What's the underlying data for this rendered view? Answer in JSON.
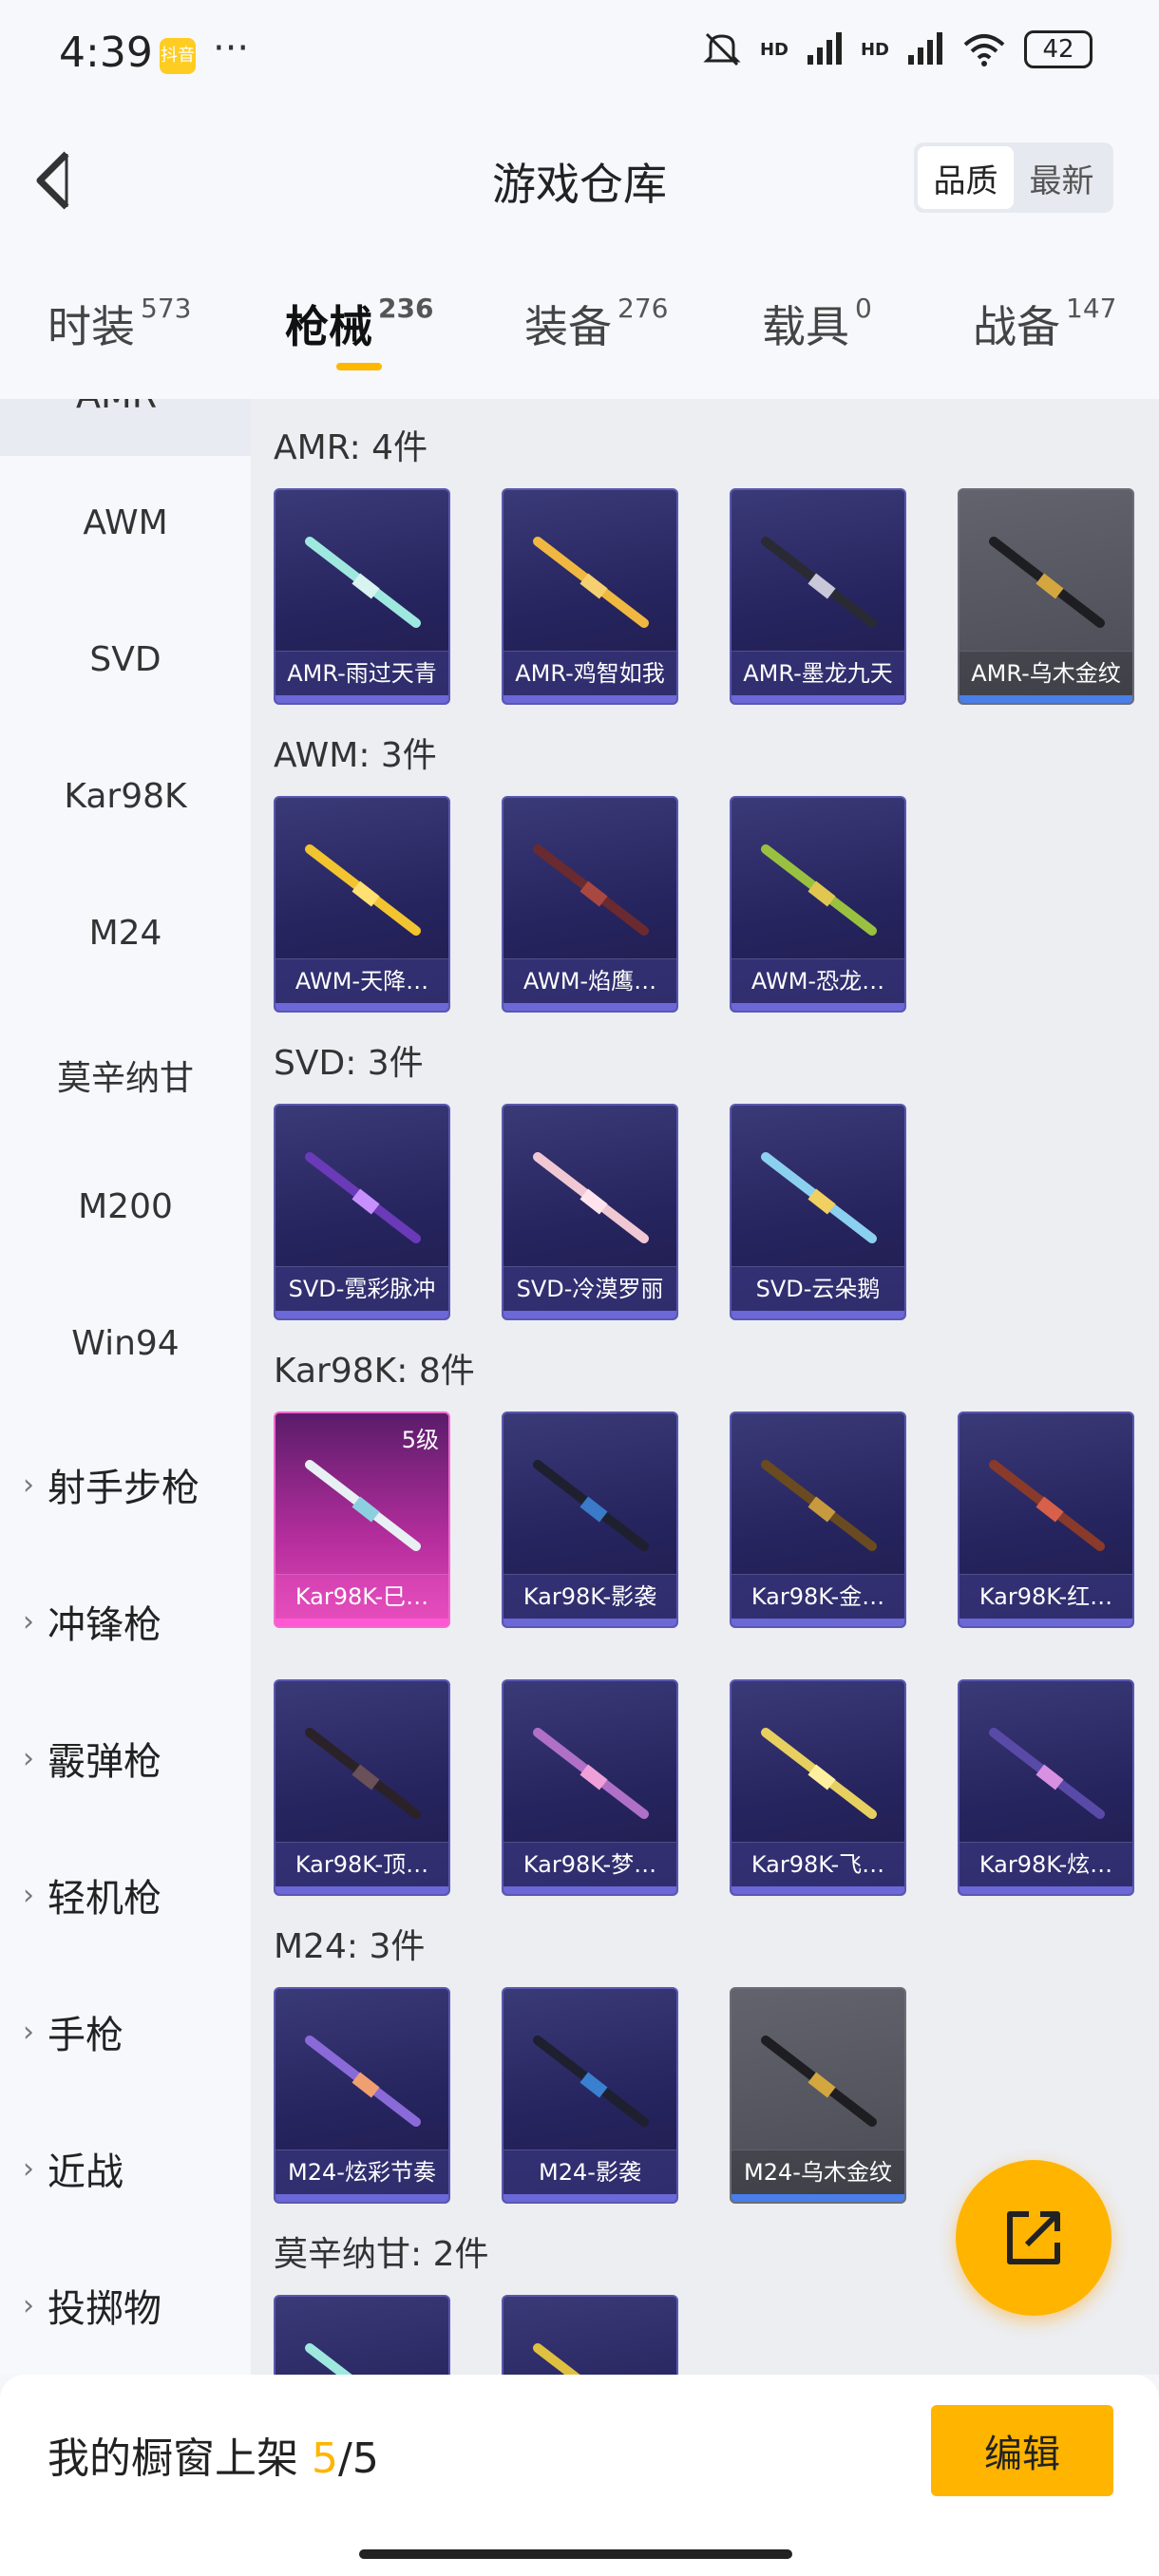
{
  "status": {
    "time": "4:39",
    "app_badge": "抖音",
    "dots": "···",
    "hd1": "HD",
    "hd2": "HD",
    "battery": "42"
  },
  "header": {
    "title": "游戏仓库",
    "sort_quality": "品质",
    "sort_latest": "最新"
  },
  "tabs": [
    {
      "label": "时装",
      "count": "573"
    },
    {
      "label": "枪械",
      "count": "236"
    },
    {
      "label": "装备",
      "count": "276"
    },
    {
      "label": "载具",
      "count": "0"
    },
    {
      "label": "战备",
      "count": "147"
    }
  ],
  "sidebar": {
    "cut_label": "AMR",
    "items": [
      "AWM",
      "SVD",
      "Kar98K",
      "M24",
      "莫辛纳甘",
      "M200",
      "Win94"
    ],
    "groups": [
      "射手步枪",
      "冲锋枪",
      "霰弹枪",
      "轻机枪",
      "手枪",
      "近战",
      "投掷物"
    ]
  },
  "sections": [
    {
      "title": "AMR: 4件",
      "cards": [
        "AMR-雨过天青",
        "AMR-鸡智如我",
        "AMR-墨龙九天",
        "AMR-乌木金纹"
      ]
    },
    {
      "title": "AWM: 3件",
      "cards": [
        "AWM-天降…",
        "AWM-焰鹰…",
        "AWM-恐龙…"
      ]
    },
    {
      "title": "SVD: 3件",
      "cards": [
        "SVD-霓彩脉冲",
        "SVD-冷漠罗丽",
        "SVD-云朵鹅"
      ]
    },
    {
      "title": "Kar98K: 8件",
      "level": "5级",
      "cards": [
        "Kar98K-巳…",
        "Kar98K-影袭",
        "Kar98K-金…",
        "Kar98K-红…",
        "Kar98K-顶…",
        "Kar98K-梦…",
        "Kar98K-飞…",
        "Kar98K-炫…"
      ]
    },
    {
      "title": "M24: 3件",
      "cards": [
        "M24-炫彩节奏",
        "M24-影袭",
        "M24-乌木金纹"
      ]
    },
    {
      "title": "莫辛纳甘: 2件"
    }
  ],
  "footer": {
    "shelf_label": "我的橱窗上架 ",
    "shelf_current": "5",
    "shelf_total": "/5",
    "edit_label": "编辑"
  },
  "colors": {
    "accent": "#ffb400",
    "card_purple": "#26245e",
    "card_grey": "#55565f",
    "card_pink": "#c0349e"
  }
}
